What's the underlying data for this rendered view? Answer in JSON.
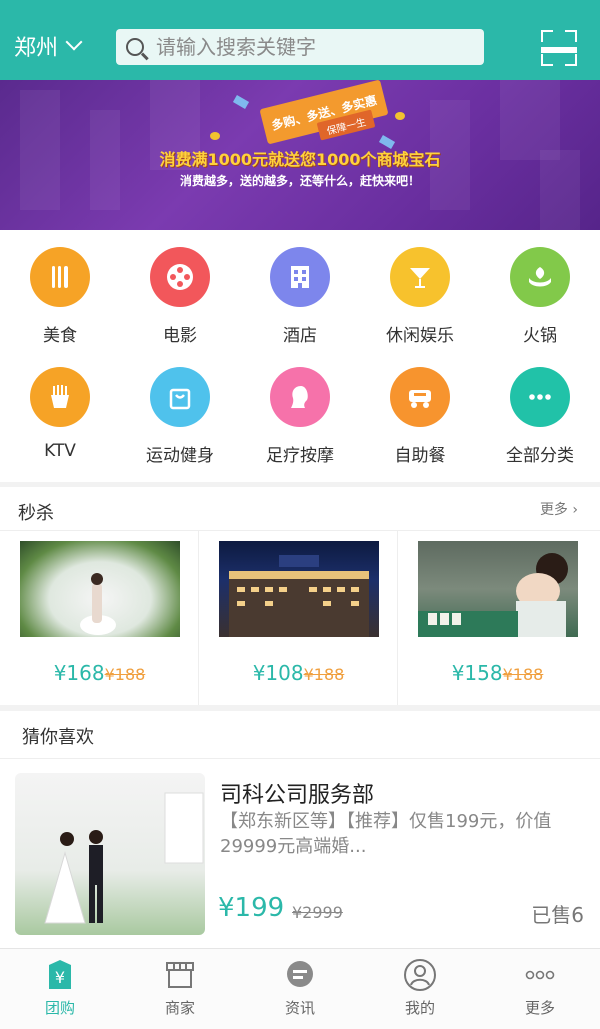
{
  "header": {
    "city": "郑州",
    "search_placeholder": "请输入搜索关键字"
  },
  "banner": {
    "ribbon": "多购、多送、多实惠",
    "ribbon_sub": "保障一生",
    "headline": "消费满1000元就送您1000个商城宝石",
    "subline": "消费越多，送的越多，还等什么，赶快来吧！"
  },
  "categories": [
    {
      "label": "美食",
      "icon": "fork-knife-icon",
      "color": "#f6a326"
    },
    {
      "label": "电影",
      "icon": "film-reel-icon",
      "color": "#f2575b"
    },
    {
      "label": "酒店",
      "icon": "building-icon",
      "color": "#7d86ec"
    },
    {
      "label": "休闲娱乐",
      "icon": "cocktail-icon",
      "color": "#f7c22d"
    },
    {
      "label": "火锅",
      "icon": "leaf-hand-icon",
      "color": "#82c94a"
    },
    {
      "label": "KTV",
      "icon": "fries-icon",
      "color": "#f6a326"
    },
    {
      "label": "运动健身",
      "icon": "bag-icon",
      "color": "#4fc2ec"
    },
    {
      "label": "足疗按摩",
      "icon": "woman-profile-icon",
      "color": "#f672aa"
    },
    {
      "label": "自助餐",
      "icon": "cart-icon",
      "color": "#f7942e"
    },
    {
      "label": "全部分类",
      "icon": "more-dots-icon",
      "color": "#21c2a8"
    }
  ],
  "seckill": {
    "title": "秒杀",
    "more": "更多 ›",
    "items": [
      {
        "price": "¥168",
        "old_price": "¥188"
      },
      {
        "price": "¥108",
        "old_price": "¥188"
      },
      {
        "price": "¥158",
        "old_price": "¥188"
      }
    ]
  },
  "guess": {
    "title": "猜你喜欢",
    "item": {
      "name": "司科公司服务部",
      "desc": "【郑东新区等】【推荐】仅售199元，价值29999元高端婚...",
      "price": "¥199",
      "old_price": "¥2999",
      "sold": "已售6"
    }
  },
  "tabs": [
    {
      "label": "团购",
      "icon": "yen-tag-icon",
      "active": true
    },
    {
      "label": "商家",
      "icon": "shop-icon",
      "active": false
    },
    {
      "label": "资讯",
      "icon": "chat-bubble-icon",
      "active": false
    },
    {
      "label": "我的",
      "icon": "user-icon",
      "active": false
    },
    {
      "label": "更多",
      "icon": "more-dots-icon",
      "active": false
    }
  ],
  "colors": {
    "accent": "#2bb8a9",
    "old_price": "#f0a040"
  }
}
